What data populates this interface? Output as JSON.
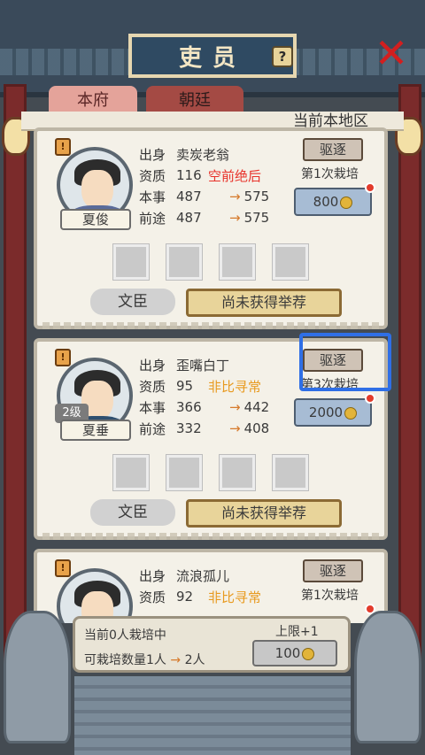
{
  "header": {
    "title": "吏员",
    "help_label": "?",
    "close_label": "✕"
  },
  "tabs": [
    {
      "label": "本府"
    },
    {
      "label": "朝廷"
    }
  ],
  "region_label": "当前本地区",
  "cards": [
    {
      "badge": "!",
      "name": "夏俊",
      "level": "",
      "fields": {
        "origin_k": "出身",
        "origin_v": "卖炭老翁",
        "aptitude_k": "资质",
        "aptitude_v": "116",
        "aptitude_tag": "空前绝后",
        "skill_k": "本事",
        "skill_v": "487",
        "skill_to": "575",
        "future_k": "前途",
        "future_v": "487",
        "future_to": "575"
      },
      "expel": "驱逐",
      "times": "第1次栽培",
      "cost": "800",
      "role": "文臣",
      "recommend": "尚未获得举荐"
    },
    {
      "badge": "!",
      "name": "夏垂",
      "level": "2级",
      "fields": {
        "origin_k": "出身",
        "origin_v": "歪嘴白丁",
        "aptitude_k": "资质",
        "aptitude_v": "95",
        "aptitude_tag": "非比寻常",
        "skill_k": "本事",
        "skill_v": "366",
        "skill_to": "442",
        "future_k": "前途",
        "future_v": "332",
        "future_to": "408"
      },
      "expel": "驱逐",
      "times": "第3次栽培",
      "cost": "2000",
      "role": "文臣",
      "recommend": "尚未获得举荐"
    },
    {
      "badge": "!",
      "name": "",
      "fields": {
        "origin_k": "出身",
        "origin_v": "流浪孤儿",
        "aptitude_k": "资质",
        "aptitude_v": "92",
        "aptitude_tag": "非比寻常"
      },
      "expel": "驱逐",
      "times": "第1次栽培"
    }
  ],
  "bottom": {
    "current": "当前0人栽培中",
    "capacity_label": "可栽培数量1人",
    "capacity_to": "2人",
    "limit": "上限+1",
    "cost": "100"
  },
  "colors": {
    "accent_red": "#e8322a",
    "accent_orange": "#e89a20",
    "highlight_blue": "#2f6fe6"
  }
}
